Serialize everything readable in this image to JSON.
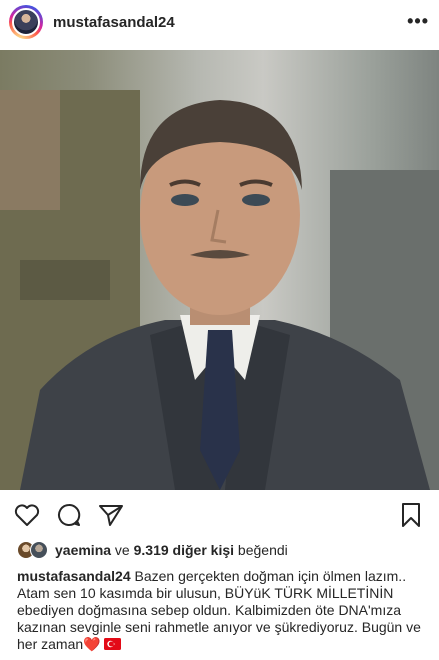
{
  "post": {
    "username": "mustafasandal24",
    "more_label": "•••"
  },
  "likes": {
    "first_user": "yaemina",
    "connector": " ve ",
    "others": "9.319 diğer kişi",
    "suffix": " beğendi"
  },
  "caption": {
    "username": "mustafasandal24",
    "text": "Bazen gerçekten doğman için ölmen lazım.. Atam sen 10 kasımda bir ulusun, BÜYüK TÜRK MİLLETİNİN ebediyen doğmasına sebep oldun. Kalbimizden öte DNA'mıza kazınan sevginle seni rahmetle anıyor ve şükrediyoruz. Bugün ve her zaman",
    "emoji_heart": "❤️"
  },
  "icons": {
    "like": "heart-icon",
    "comment": "comment-icon",
    "share": "send-icon",
    "save": "bookmark-icon",
    "flag": "turkish-flag-icon"
  }
}
